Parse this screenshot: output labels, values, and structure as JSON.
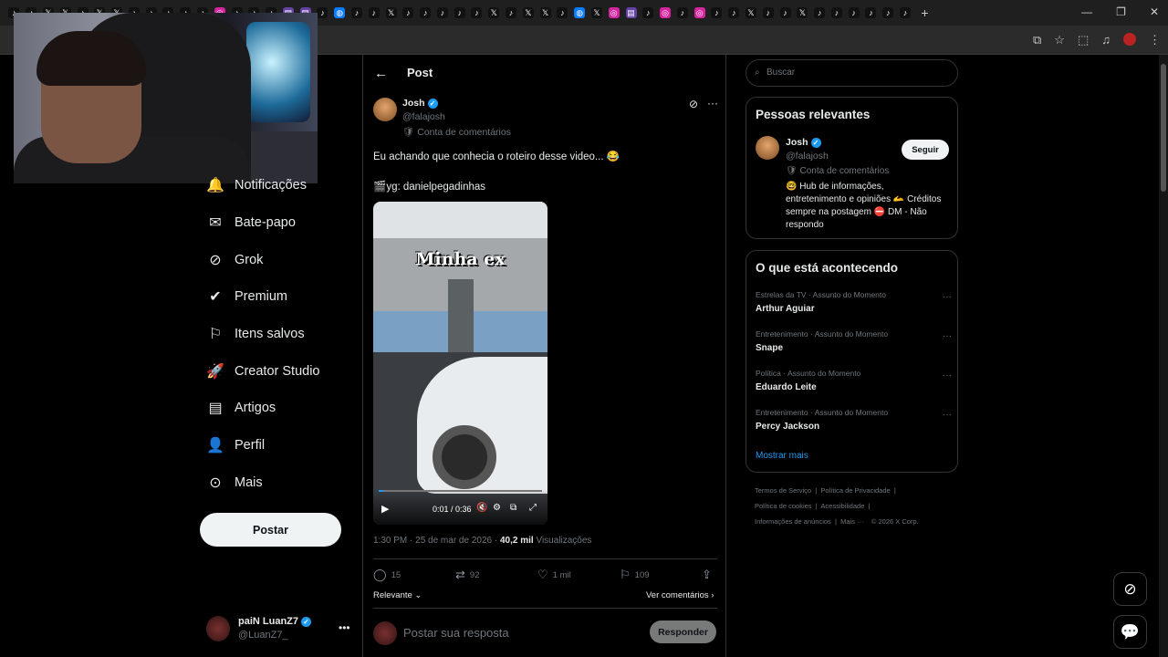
{
  "browser": {
    "tab_icons": [
      "tiktok",
      "tiktok",
      "x",
      "x",
      "tiktok",
      "x",
      "x",
      "tiktok",
      "tiktok",
      "tiktok",
      "tiktok",
      "tiktok",
      "instagram",
      "tiktok",
      "tiktok",
      "tiktok",
      "twitch",
      "twitch",
      "tiktok",
      "messenger",
      "tiktok",
      "tiktok",
      "x",
      "tiktok",
      "tiktok",
      "tiktok",
      "tiktok",
      "tiktok",
      "x",
      "tiktok",
      "x",
      "x",
      "tiktok",
      "messenger",
      "x",
      "instagram",
      "twitch",
      "tiktok",
      "instagram",
      "tiktok",
      "instagram",
      "tiktok",
      "tiktok",
      "x",
      "tiktok",
      "tiktok",
      "x",
      "tiktok",
      "tiktok",
      "tiktok",
      "tiktok",
      "tiktok",
      "tiktok"
    ],
    "new_tab_label": "+"
  },
  "nav": {
    "items": [
      {
        "label": "Notificações",
        "icon": "bell-icon"
      },
      {
        "label": "Bate-papo",
        "icon": "mail-icon"
      },
      {
        "label": "Grok",
        "icon": "grok-icon"
      },
      {
        "label": "Premium",
        "icon": "verified-icon"
      },
      {
        "label": "Itens salvos",
        "icon": "bookmark-icon"
      },
      {
        "label": "Creator Studio",
        "icon": "rocket-icon"
      },
      {
        "label": "Artigos",
        "icon": "article-icon"
      },
      {
        "label": "Perfil",
        "icon": "person-icon"
      },
      {
        "label": "Mais",
        "icon": "more-circle-icon"
      }
    ],
    "post_button": "Postar",
    "account": {
      "name": "paiN LuanZ7",
      "handle": "@LuanZ7_"
    }
  },
  "post": {
    "header_title": "Post",
    "author_name": "Josh",
    "author_handle": "@falajosh",
    "account_label": "Conta de comentários",
    "text_line1": "Eu achando que conhecia o roteiro desse video... 😂",
    "text_line2": "yg: danielpegadinhas",
    "video": {
      "caption": "Minha ex",
      "time": "0:01 / 0:36",
      "progress": 0.028
    },
    "time": "1:30 PM · 25 de mar de 2026 ·",
    "views_count": "40,2 mil",
    "views_label": "Visualizações",
    "replies": "15",
    "reposts": "92",
    "likes": "1 mil",
    "bookmarks": "109",
    "sort_label": "Relevante",
    "view_comments": "Ver comentários",
    "reply_placeholder": "Postar sua resposta",
    "reply_button": "Responder"
  },
  "search": {
    "placeholder": "Buscar"
  },
  "relevant": {
    "title": "Pessoas relevantes",
    "name": "Josh",
    "handle": "@falajosh",
    "account_label": "Conta de comentários",
    "bio_line1": "🤓 Hub de informações,",
    "bio_line2": "entretenimento e opiniões 🫴 Créditos",
    "bio_line3": "sempre na postagem ⛔ DM - Não",
    "bio_line4": "respondo",
    "follow_button": "Seguir"
  },
  "trends": {
    "title": "O que está acontecendo",
    "items": [
      {
        "context": "Estrelas da TV · Assunto do Momento",
        "name": "Arthur Aguiar"
      },
      {
        "context": "Entretenimento · Assunto do Momento",
        "name": "Snape"
      },
      {
        "context": "Política · Assunto do Momento",
        "name": "Eduardo Leite"
      },
      {
        "context": "Entretenimento · Assunto do Momento",
        "name": "Percy Jackson"
      }
    ],
    "show_more": "Mostrar mais"
  },
  "footer": {
    "terms": "Termos de Serviço",
    "privacy": "Política de Privacidade",
    "cookies": "Política de cookies",
    "accessibility": "Acessibilidade",
    "ads": "Informações de anúncios",
    "more": "Mais ···",
    "copyright": "© 2026 X Corp."
  },
  "colors": {
    "accent": "#1d9bf0",
    "background": "#000000",
    "border": "#2f3336"
  }
}
